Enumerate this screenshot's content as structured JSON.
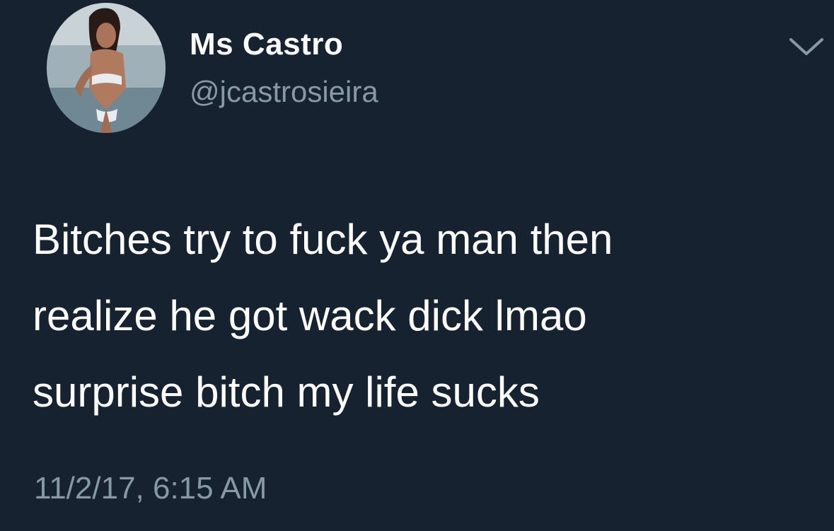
{
  "tweet": {
    "author": {
      "display_name": "Ms Castro",
      "handle": "@jcastrosieira",
      "avatar_icon": "profile-photo"
    },
    "menu_icon": "chevron-down-icon",
    "text_lines": [
      "Bitches try to fuck ya man then",
      "realize he got wack dick lmao",
      "surprise bitch my life sucks"
    ],
    "timestamp": "11/2/17, 6:15 AM"
  },
  "colors": {
    "background": "#172230",
    "primary_text": "#ffffff",
    "secondary_text": "#8899a6"
  }
}
